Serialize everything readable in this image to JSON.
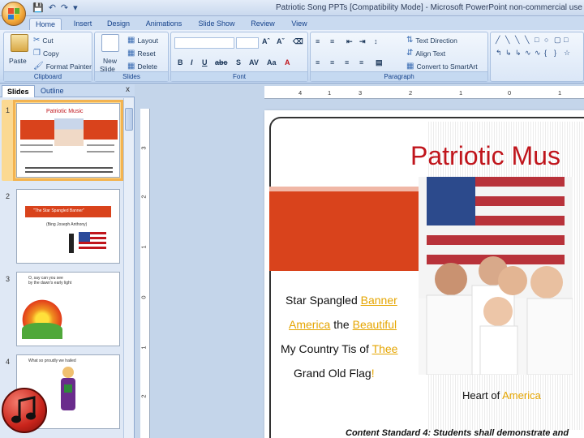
{
  "window": {
    "title": "Patriotic Song PPTs [Compatibility Mode] - Microsoft PowerPoint non-commercial use"
  },
  "tabs": [
    "Home",
    "Insert",
    "Design",
    "Animations",
    "Slide Show",
    "Review",
    "View"
  ],
  "ribbon": {
    "clipboard": {
      "paste": "Paste",
      "cut": "Cut",
      "copy": "Copy",
      "format_painter": "Format Painter",
      "label": "Clipboard"
    },
    "slides": {
      "new_slide_1": "New",
      "new_slide_2": "Slide",
      "layout": "Layout",
      "reset": "Reset",
      "delete": "Delete",
      "label": "Slides"
    },
    "font": {
      "label": "Font"
    },
    "paragraph": {
      "text_direction": "Text Direction",
      "align_text": "Align Text",
      "convert_smartart": "Convert to SmartArt",
      "label": "Paragraph"
    }
  },
  "left_pane": {
    "tab_slides": "Slides",
    "tab_outline": "Outline",
    "close": "x",
    "slides": [
      {
        "num": "1",
        "title": "Patriotic Music"
      },
      {
        "num": "2",
        "title": "\"The Star Spangled Banner\"",
        "sub": "(Bing Joseph Anthony)"
      },
      {
        "num": "3",
        "text": "O, say can you see\nby the dawn's early light"
      },
      {
        "num": "4",
        "text": "What so proudly we hailed"
      }
    ]
  },
  "ruler": {
    "h": [
      "4",
      "1",
      "3",
      "2",
      "1",
      "0",
      "1"
    ],
    "v": [
      "3",
      "2",
      "1",
      "0",
      "1",
      "2"
    ]
  },
  "slide": {
    "title": "Patriotic Mus",
    "links": [
      {
        "pre": "Star Spangled ",
        "link": "Banner",
        "post": ""
      },
      {
        "pre": "",
        "link": "America",
        "post": " the ",
        "link2": "Beautiful"
      },
      {
        "pre": "My Country Tis of ",
        "link": "Thee",
        "post": ""
      },
      {
        "pre": "Grand Old Flag",
        "link": "",
        "post": "",
        "bang": "!"
      }
    ],
    "heart_pre": "Heart of ",
    "heart_link": "America",
    "footer": "Content Standard 4: Students shall demonstrate and"
  },
  "colors": {
    "accent_red": "#c0151c",
    "link_gold": "#e5a500",
    "bar_orange": "#d9431c"
  }
}
